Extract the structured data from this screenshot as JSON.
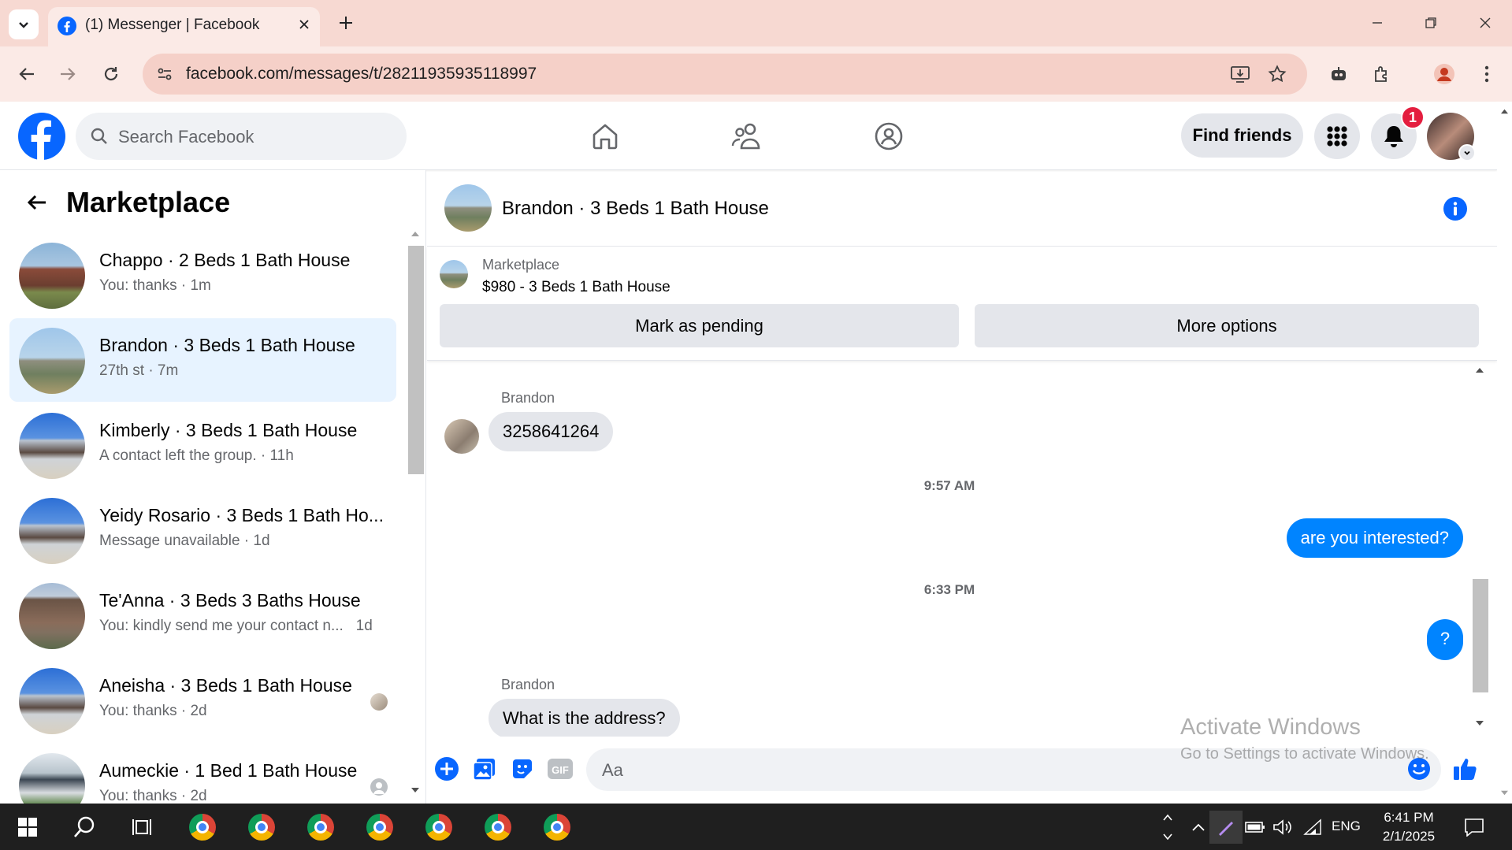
{
  "browser": {
    "tab_title": "(1) Messenger | Facebook",
    "url": "facebook.com/messages/t/28211935935118997"
  },
  "fb_header": {
    "search_placeholder": "Search Facebook",
    "find_friends": "Find friends",
    "notification_count": "1"
  },
  "left_panel": {
    "title": "Marketplace",
    "conversations": [
      {
        "name": "Chappo · 2 Beds 1 Bath House",
        "preview": "You: thanks · 1m",
        "active": false
      },
      {
        "name": "Brandon · 3 Beds 1 Bath House",
        "preview": "27th st · 7m",
        "active": true
      },
      {
        "name": "Kimberly · 3 Beds 1 Bath House",
        "preview": "A contact left the group. · 11h",
        "active": false
      },
      {
        "name": "Yeidy Rosario · 3 Beds 1 Bath Ho...",
        "preview": "Message unavailable · 1d",
        "active": false
      },
      {
        "name": "Te'Anna · 3 Beds 3 Baths House",
        "preview": "You: kindly send me your contact n...   1d",
        "active": false
      },
      {
        "name": "Aneisha · 3 Beds 1 Bath House",
        "preview": "You: thanks · 2d",
        "active": false
      },
      {
        "name": "Aumeckie · 1 Bed 1 Bath House",
        "preview": "You: thanks · 2d",
        "active": false
      }
    ]
  },
  "chat": {
    "title": "Brandon · 3 Beds 1 Bath House",
    "marketplace_label": "Marketplace",
    "listing": "$980 - 3 Beds 1 Bath House",
    "mark_pending": "Mark as pending",
    "more_options": "More options",
    "messages": {
      "sender1": "Brandon",
      "msg1": "3258641264",
      "time1": "9:57 AM",
      "msg2": "are you interested?",
      "time2": "6:33 PM",
      "msg3": "?",
      "sender2": "Brandon",
      "msg4": "What is the address?"
    },
    "composer_placeholder": "Aa"
  },
  "watermark": {
    "line1": "Activate Windows",
    "line2": "Go to Settings to activate Windows."
  },
  "taskbar": {
    "language": "ENG",
    "time": "6:41 PM",
    "date": "2/1/2025"
  },
  "colors": {
    "fb_blue": "#0866ff",
    "messenger_blue": "#0084ff",
    "notification_red": "#e41e3f",
    "active_conv": "#e7f3ff"
  }
}
